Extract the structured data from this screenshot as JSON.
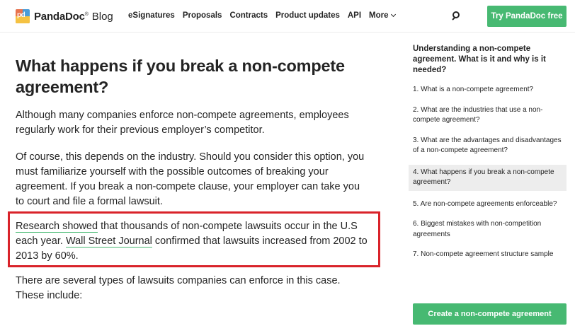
{
  "header": {
    "brand": "PandaDoc",
    "brand_reg": "®",
    "brand_suffix": "Blog",
    "logo_glyph": "pd",
    "nav": [
      "eSignatures",
      "Proposals",
      "Contracts",
      "Product updates",
      "API"
    ],
    "more_label": "More",
    "search_icon": "search-icon",
    "cta_label": "Try PandaDoc free"
  },
  "article": {
    "title": "What happens if you break a non-compete agreement?",
    "p1": "Although many companies enforce non-compete agreements, employees regularly work for their previous employer’s competitor.",
    "p2": "Of course, this depends on the industry. Should you consider this option, you must familiarize yourself with the possible outcomes of breaking your agreement. If you break a non-compete clause, your employer can take you to court and file a formal lawsuit.",
    "p3_link1": "Research showed",
    "p3_text1": " that thousands of non-compete lawsuits occur in the U.S each year. ",
    "p3_link2": "Wall Street Journal",
    "p3_text2": " confirmed that lawsuits increased from 2002 to 2013 by 60%.",
    "p4": "There are several types of lawsuits companies can enforce in this case. These include:"
  },
  "toc": {
    "title": "Understanding a non-compete agreement. What is it and why is it needed?",
    "items": [
      "1. What is a non-compete agreement?",
      "2. What are the industries that use a non-compete agreement?",
      "3. What are the advantages and disadvantages of a non-compete agreement?",
      "4. What happens if you break a non-compete agreement?",
      "5. Are non-compete agreements enforceable?",
      "6. Biggest mistakes with non-competition agreements",
      "7. Non-compete agreement structure sample"
    ],
    "active_index": 3,
    "cta_label": "Create a non-compete agreement"
  },
  "colors": {
    "accent": "#47b972",
    "highlight": "#d9232a",
    "active_bg": "#ededed"
  }
}
